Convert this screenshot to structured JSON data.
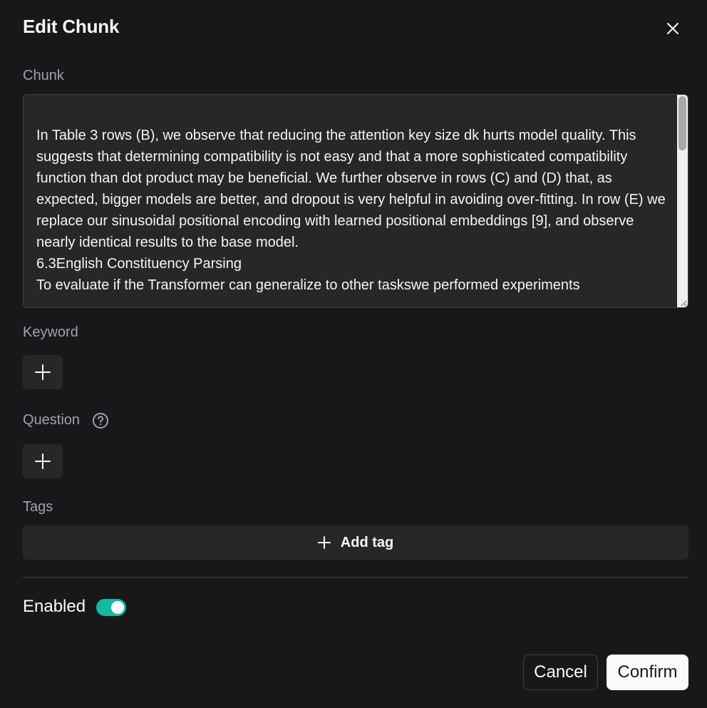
{
  "dialog": {
    "title": "Edit Chunk",
    "close_icon": "close-icon"
  },
  "chunk": {
    "label": "Chunk",
    "text": "In Table 3 rows (B), we observe that reducing the attention key size dk hurts model quality. This suggests that determining compatibility is not easy and that a more sophisticated compatibility function than dot product may be beneficial. We further observe in rows (C) and (D) that, as expected, bigger models are better, and dropout is very helpful in avoiding over-fitting. In row (E) we replace our sinusoidal positional encoding with learned positional embeddings [9], and observe nearly identical results to the base model.\n6.3English Constituency Parsing\nTo evaluate if the Transformer can generalize to other taskswe performed experiments"
  },
  "keyword": {
    "label": "Keyword",
    "add_icon": "plus-icon"
  },
  "question": {
    "label": "Question",
    "help_icon": "help-circle-icon",
    "add_icon": "plus-icon"
  },
  "tags": {
    "label": "Tags",
    "add_label": "Add tag",
    "add_icon": "plus-icon"
  },
  "enabled": {
    "label": "Enabled",
    "value": true
  },
  "footer": {
    "cancel_label": "Cancel",
    "confirm_label": "Confirm"
  },
  "colors": {
    "background": "#18181b",
    "field": "#27272a",
    "toggle_on": "#14b8a6",
    "muted_text": "#a1a1aa"
  }
}
